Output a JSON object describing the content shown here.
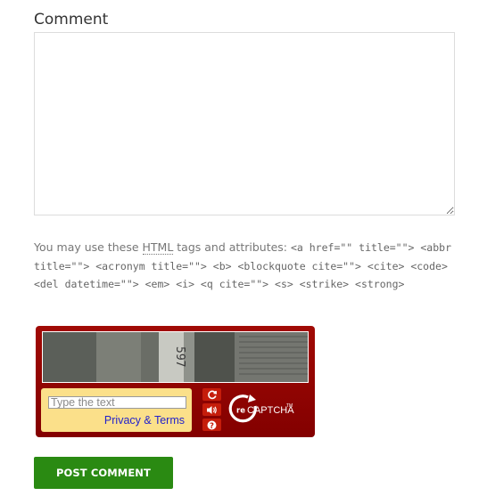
{
  "form": {
    "comment_label": "Comment",
    "comment_value": "",
    "allowed_prefix": "You may use these ",
    "allowed_abbr": "HTML",
    "allowed_middle": " tags and attributes: ",
    "allowed_tags": "<a href=\"\" title=\"\"> <abbr title=\"\"> <acronym title=\"\"> <b> <blockquote cite=\"\"> <cite> <code> <del datetime=\"\"> <em> <i> <q cite=\"\"> <s> <strike> <strong>",
    "submit_label": "POST COMMENT"
  },
  "recaptcha": {
    "input_placeholder": "Type the text",
    "privacy_link": "Privacy & Terms",
    "image_digits": "597",
    "logo_prefix": "re",
    "logo_text": "CAPTCHA",
    "logo_tm": "TM",
    "controls": [
      "refresh-icon",
      "audio-icon",
      "help-icon"
    ]
  },
  "colors": {
    "captcha_frame": "#8b0000",
    "answer_panel": "#fbe08a",
    "control_button": "#c51d0b",
    "submit_button": "#2a8a12",
    "link": "#2222cc"
  }
}
